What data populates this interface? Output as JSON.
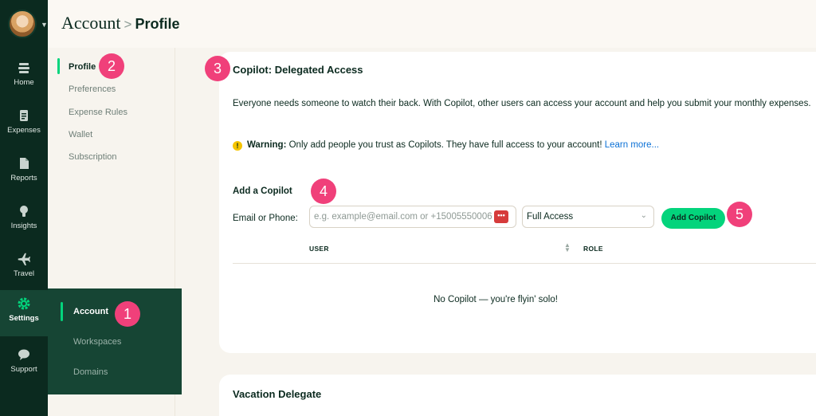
{
  "rail": {
    "items": [
      {
        "label": "Home",
        "icon": "home-icon"
      },
      {
        "label": "Expenses",
        "icon": "receipt-icon"
      },
      {
        "label": "Reports",
        "icon": "document-icon"
      },
      {
        "label": "Insights",
        "icon": "lightbulb-icon"
      },
      {
        "label": "Travel",
        "icon": "plane-icon"
      },
      {
        "label": "Settings",
        "icon": "gear-icon"
      },
      {
        "label": "Support",
        "icon": "chat-bubble-icon"
      }
    ],
    "active": "Settings"
  },
  "header": {
    "crumb_parent": "Account",
    "crumb_current": "Profile"
  },
  "subnav": {
    "items": [
      "Profile",
      "Preferences",
      "Expense Rules",
      "Wallet",
      "Subscription"
    ],
    "active": "Profile"
  },
  "settings_flyout": {
    "items": [
      "Account",
      "Workspaces",
      "Domains"
    ],
    "active": "Account"
  },
  "copilot": {
    "title": "Copilot: Delegated Access",
    "description": "Everyone needs someone to watch their back. With Copilot, other users can access your account and help you submit your monthly expenses.",
    "warning_label": "Warning:",
    "warning_text": " Only add people you trust as Copilots. They have full access to your account! ",
    "learn_more": "Learn more...",
    "add_title": "Add a Copilot",
    "field_label": "Email or Phone:",
    "input_placeholder": "e.g. example@email.com or +15005550006",
    "access_selected": "Full Access",
    "add_button": "Add Copilot",
    "table_headers": {
      "user": "USER",
      "role": "ROLE"
    },
    "empty_text": "No Copilot — you're flyin' solo!"
  },
  "vacation": {
    "title": "Vacation Delegate"
  },
  "badges": [
    "1",
    "2",
    "3",
    "4",
    "5"
  ],
  "colors": {
    "rail_bg": "#0b2a1f",
    "flyout_bg": "#164534",
    "accent_green": "#03d47c",
    "badge_pink": "#f0407a",
    "link_blue": "#0c71d6"
  }
}
